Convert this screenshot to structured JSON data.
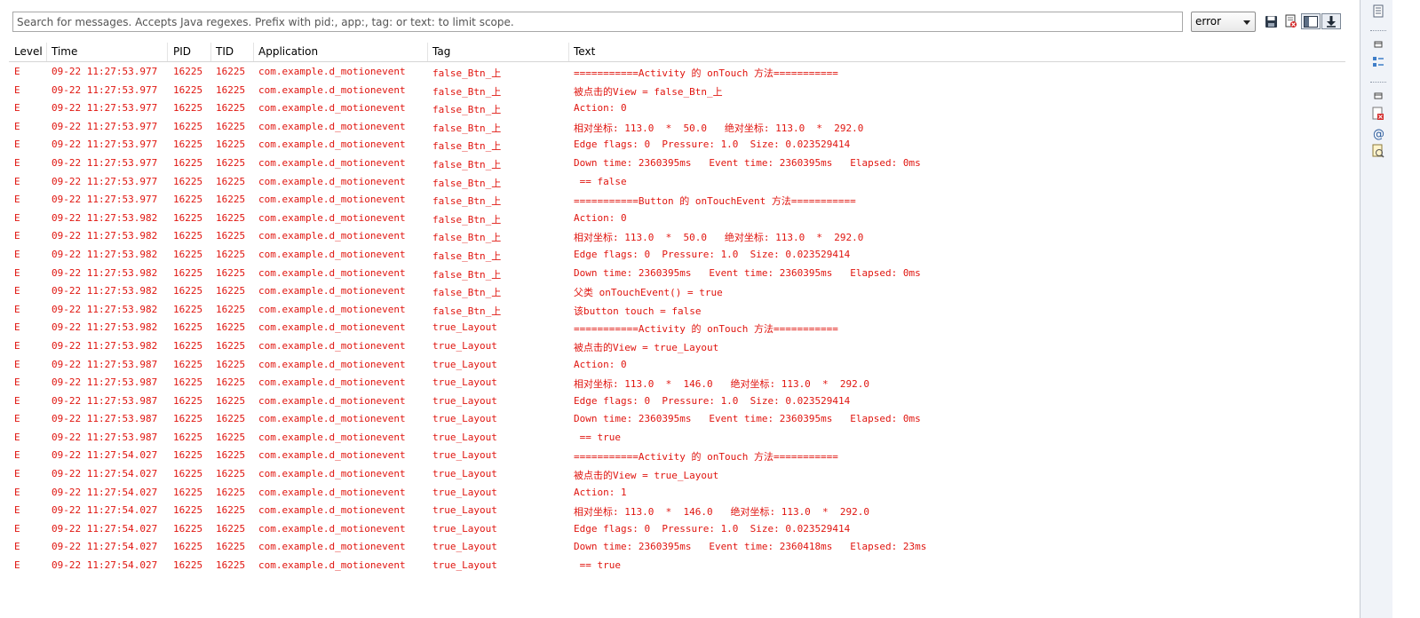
{
  "search": {
    "placeholder": "Search for messages. Accepts Java regexes. Prefix with pid:, app:, tag: or text: to limit scope.",
    "value": ""
  },
  "level_select": {
    "value": "error"
  },
  "toolbar": {
    "save_icon": "save-icon",
    "clear_icon": "clear-log-icon",
    "toggle_filters_icon": "toggle-panel-icon",
    "scroll_lock_icon": "scroll-lock-icon"
  },
  "table": {
    "columns": [
      "Level",
      "Time",
      "PID",
      "TID",
      "Application",
      "Tag",
      "Text"
    ],
    "rows": [
      [
        "E",
        "09-22 11:27:53.977",
        "16225",
        "16225",
        "com.example.d_motionevent",
        "false_Btn_上",
        "===========Activity 的 onTouch 方法==========="
      ],
      [
        "E",
        "09-22 11:27:53.977",
        "16225",
        "16225",
        "com.example.d_motionevent",
        "false_Btn_上",
        "被点击的View = false_Btn_上"
      ],
      [
        "E",
        "09-22 11:27:53.977",
        "16225",
        "16225",
        "com.example.d_motionevent",
        "false_Btn_上",
        "Action: 0"
      ],
      [
        "E",
        "09-22 11:27:53.977",
        "16225",
        "16225",
        "com.example.d_motionevent",
        "false_Btn_上",
        "相对坐标: 113.0  *  50.0   绝对坐标: 113.0  *  292.0"
      ],
      [
        "E",
        "09-22 11:27:53.977",
        "16225",
        "16225",
        "com.example.d_motionevent",
        "false_Btn_上",
        "Edge flags: 0  Pressure: 1.0  Size: 0.023529414"
      ],
      [
        "E",
        "09-22 11:27:53.977",
        "16225",
        "16225",
        "com.example.d_motionevent",
        "false_Btn_上",
        "Down time: 2360395ms   Event time: 2360395ms   Elapsed: 0ms"
      ],
      [
        "E",
        "09-22 11:27:53.977",
        "16225",
        "16225",
        "com.example.d_motionevent",
        "false_Btn_上",
        " == false"
      ],
      [
        "E",
        "09-22 11:27:53.977",
        "16225",
        "16225",
        "com.example.d_motionevent",
        "false_Btn_上",
        "===========Button 的 onTouchEvent 方法==========="
      ],
      [
        "E",
        "09-22 11:27:53.982",
        "16225",
        "16225",
        "com.example.d_motionevent",
        "false_Btn_上",
        "Action: 0"
      ],
      [
        "E",
        "09-22 11:27:53.982",
        "16225",
        "16225",
        "com.example.d_motionevent",
        "false_Btn_上",
        "相对坐标: 113.0  *  50.0   绝对坐标: 113.0  *  292.0"
      ],
      [
        "E",
        "09-22 11:27:53.982",
        "16225",
        "16225",
        "com.example.d_motionevent",
        "false_Btn_上",
        "Edge flags: 0  Pressure: 1.0  Size: 0.023529414"
      ],
      [
        "E",
        "09-22 11:27:53.982",
        "16225",
        "16225",
        "com.example.d_motionevent",
        "false_Btn_上",
        "Down time: 2360395ms   Event time: 2360395ms   Elapsed: 0ms"
      ],
      [
        "E",
        "09-22 11:27:53.982",
        "16225",
        "16225",
        "com.example.d_motionevent",
        "false_Btn_上",
        "父类 onTouchEvent() = true"
      ],
      [
        "E",
        "09-22 11:27:53.982",
        "16225",
        "16225",
        "com.example.d_motionevent",
        "false_Btn_上",
        "该button touch = false"
      ],
      [
        "E",
        "09-22 11:27:53.982",
        "16225",
        "16225",
        "com.example.d_motionevent",
        "true_Layout",
        "===========Activity 的 onTouch 方法==========="
      ],
      [
        "E",
        "09-22 11:27:53.982",
        "16225",
        "16225",
        "com.example.d_motionevent",
        "true_Layout",
        "被点击的View = true_Layout"
      ],
      [
        "E",
        "09-22 11:27:53.987",
        "16225",
        "16225",
        "com.example.d_motionevent",
        "true_Layout",
        "Action: 0"
      ],
      [
        "E",
        "09-22 11:27:53.987",
        "16225",
        "16225",
        "com.example.d_motionevent",
        "true_Layout",
        "相对坐标: 113.0  *  146.0   绝对坐标: 113.0  *  292.0"
      ],
      [
        "E",
        "09-22 11:27:53.987",
        "16225",
        "16225",
        "com.example.d_motionevent",
        "true_Layout",
        "Edge flags: 0  Pressure: 1.0  Size: 0.023529414"
      ],
      [
        "E",
        "09-22 11:27:53.987",
        "16225",
        "16225",
        "com.example.d_motionevent",
        "true_Layout",
        "Down time: 2360395ms   Event time: 2360395ms   Elapsed: 0ms"
      ],
      [
        "E",
        "09-22 11:27:53.987",
        "16225",
        "16225",
        "com.example.d_motionevent",
        "true_Layout",
        " == true"
      ],
      [
        "E",
        "09-22 11:27:54.027",
        "16225",
        "16225",
        "com.example.d_motionevent",
        "true_Layout",
        "===========Activity 的 onTouch 方法==========="
      ],
      [
        "E",
        "09-22 11:27:54.027",
        "16225",
        "16225",
        "com.example.d_motionevent",
        "true_Layout",
        "被点击的View = true_Layout"
      ],
      [
        "E",
        "09-22 11:27:54.027",
        "16225",
        "16225",
        "com.example.d_motionevent",
        "true_Layout",
        "Action: 1"
      ],
      [
        "E",
        "09-22 11:27:54.027",
        "16225",
        "16225",
        "com.example.d_motionevent",
        "true_Layout",
        "相对坐标: 113.0  *  146.0   绝对坐标: 113.0  *  292.0"
      ],
      [
        "E",
        "09-22 11:27:54.027",
        "16225",
        "16225",
        "com.example.d_motionevent",
        "true_Layout",
        "Edge flags: 0  Pressure: 1.0  Size: 0.023529414"
      ],
      [
        "E",
        "09-22 11:27:54.027",
        "16225",
        "16225",
        "com.example.d_motionevent",
        "true_Layout",
        "Down time: 2360395ms   Event time: 2360418ms   Elapsed: 23ms"
      ],
      [
        "E",
        "09-22 11:27:54.027",
        "16225",
        "16225",
        "com.example.d_motionevent",
        "true_Layout",
        " == true"
      ]
    ]
  },
  "colors": {
    "error_text": "#e0150f",
    "sidebar_bg": "#f0f3f8"
  },
  "sidebar": {
    "icons": [
      "outline-icon",
      "minimize-icon",
      "task-list-icon",
      "minimize-icon",
      "problems-icon",
      "javadoc-icon",
      "declaration-icon"
    ]
  }
}
